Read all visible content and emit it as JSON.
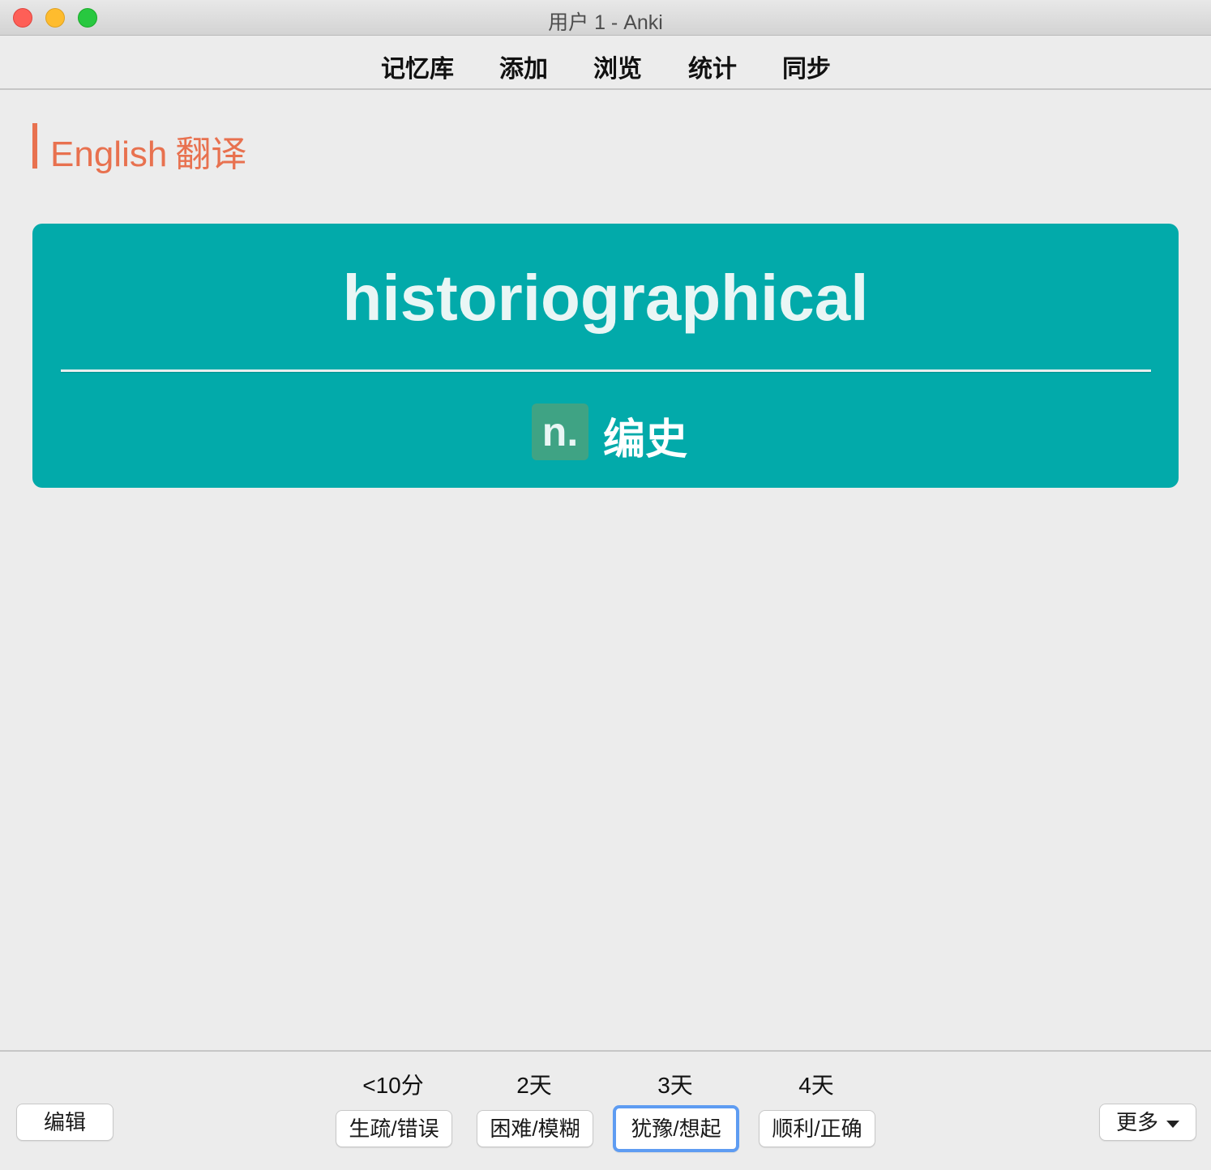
{
  "window": {
    "title": "用户 1 - Anki"
  },
  "topnav": {
    "items": [
      "记忆库",
      "添加",
      "浏览",
      "统计",
      "同步"
    ]
  },
  "deck": {
    "name_en": "English",
    "name_cn": "翻译"
  },
  "card": {
    "word": "historiographical",
    "pos": "n.",
    "meaning": "编史",
    "background_color": "#02aaaa"
  },
  "bottom": {
    "edit_label": "编辑",
    "more_label": "更多",
    "answers": [
      {
        "interval": "<10分",
        "label": "生疏/错误"
      },
      {
        "interval": "2天",
        "label": "困难/模糊"
      },
      {
        "interval": "3天",
        "label": "犹豫/想起"
      },
      {
        "interval": "4天",
        "label": "顺利/正确"
      }
    ]
  },
  "colors": {
    "accent": "#e8714f",
    "focus_ring": "#5e9cf2"
  }
}
